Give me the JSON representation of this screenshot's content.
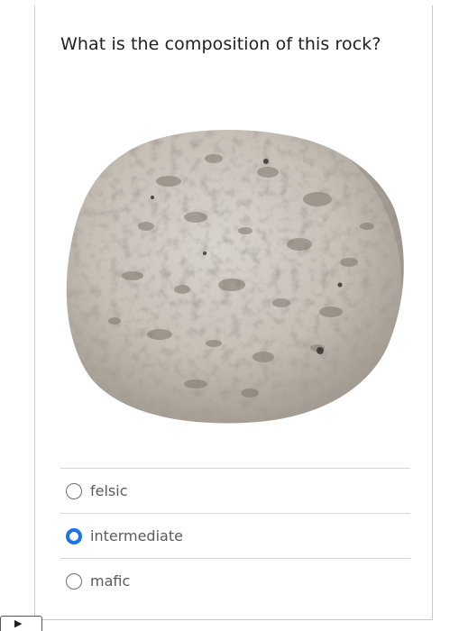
{
  "question": {
    "text": "What is the composition of this rock?"
  },
  "image": {
    "subject": "rock-photo"
  },
  "options": [
    {
      "label": "felsic",
      "selected": false
    },
    {
      "label": "intermediate",
      "selected": true
    },
    {
      "label": "mafic",
      "selected": false
    }
  ],
  "colors": {
    "selected_radio": "#1a73e8",
    "rock_base": "#c9c3bb",
    "rock_shadow": "#8f877d"
  },
  "corner_tab": {
    "icon": "play-arrow-icon"
  }
}
